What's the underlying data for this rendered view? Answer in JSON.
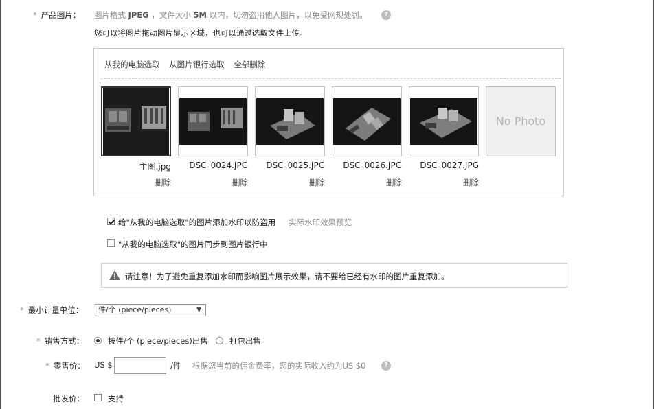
{
  "product_image": {
    "label": "产品图片：",
    "required_mark": "*",
    "hint_prefix": "图片格式 ",
    "hint_format": "JPEG",
    "hint_middle": " ，文件大小 ",
    "hint_size": "5M",
    "hint_suffix": " 以内，切勿盗用他人图片，以免受网规处罚。",
    "help_icon": "question-icon",
    "drag_hint": "您可以将图片拖动图片显示区域，也可以通过选取文件上传。",
    "links": [
      "从我的电脑选取",
      "从图片银行选取",
      "全部删除"
    ],
    "thumbnails": [
      {
        "name": "主图.jpg",
        "delete": "删除"
      },
      {
        "name": "DSC_0024.JPG",
        "delete": "删除"
      },
      {
        "name": "DSC_0025.JPG",
        "delete": "删除"
      },
      {
        "name": "DSC_0026.JPG",
        "delete": "删除"
      },
      {
        "name": "DSC_0027.JPG",
        "delete": "删除"
      }
    ],
    "no_photo": "No Photo"
  },
  "watermark": {
    "label": "给\"从我的电脑选取\"的图片添加水印以防盗用",
    "checked": true,
    "preview_link": "实际水印效果预览"
  },
  "sync_bank": {
    "label": "\"从我的电脑选取\"的图片同步到图片银行中",
    "checked": false
  },
  "notice": {
    "icon": "warning-icon",
    "text": "请注意！为了避免重复添加水印而影响图片展示效果，请不要给已经有水印的图片重复添加。"
  },
  "min_unit": {
    "label": "最小计量单位：",
    "required_mark": "*",
    "selected": "件/个 (piece/pieces)"
  },
  "sale_method": {
    "label": "销售方式：",
    "required_mark": "*",
    "options": [
      "按件/个 (piece/pieces)出售",
      "打包出售"
    ],
    "selected_index": 0
  },
  "retail_price": {
    "label": "零售价：",
    "required_mark": "*",
    "currency": "US $",
    "value": "",
    "unit": "/件",
    "hint": "根据您当前的佣金费率，您的实际收入约为US $0",
    "help_icon": "question-icon"
  },
  "wholesale_price": {
    "label": "批发价：",
    "option": "支持",
    "checked": false
  },
  "colors": {
    "border": "#c8c8c8",
    "hint_text": "#8a8a8a",
    "no_photo_bg": "#efefef"
  }
}
